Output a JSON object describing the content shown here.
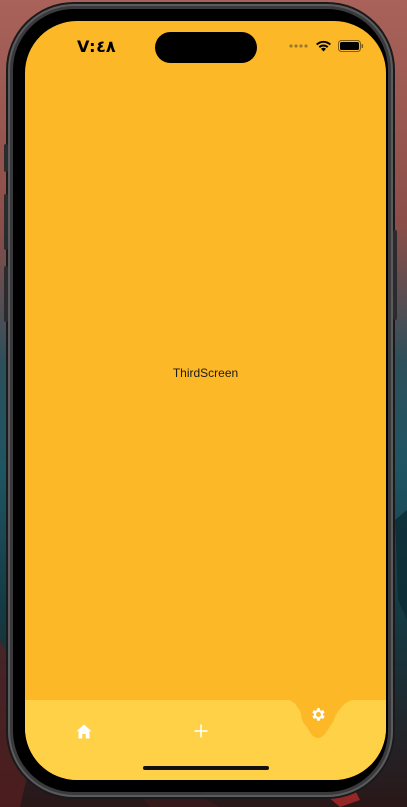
{
  "status_bar": {
    "time": "V:٤٨"
  },
  "main": {
    "screen_label": "ThirdScreen"
  },
  "bottom_nav": {
    "items": [
      {
        "icon": "home-icon"
      },
      {
        "icon": "plus-icon"
      },
      {
        "icon": "gear-icon",
        "active": true
      }
    ],
    "colors": {
      "background": "#ffd146",
      "screen": "#fdb827",
      "icon": "#ffffff"
    }
  }
}
